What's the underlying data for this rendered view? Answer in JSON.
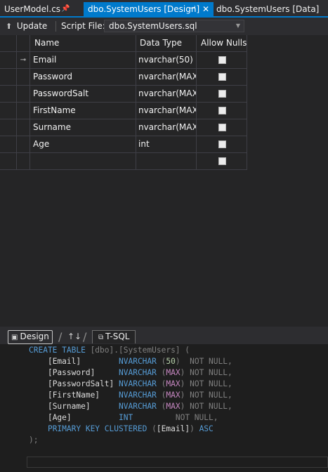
{
  "tabs": [
    {
      "label": "UserModel.cs",
      "pin": "📌"
    },
    {
      "label": "dbo.SystemUsers [Design]",
      "pin": "⊣",
      "close": "✕"
    },
    {
      "label": "dbo.SystemUsers [Data]"
    }
  ],
  "toolbar": {
    "update_label": "Update",
    "script_file_label": "Script File:",
    "script_file_value": "dbo.SystemUsers.sql"
  },
  "grid": {
    "headers": [
      "Name",
      "Data Type",
      "Allow Nulls"
    ],
    "rows": [
      {
        "name": "Email",
        "type": "nvarchar(50)",
        "allow_nulls": false,
        "primary_key": true
      },
      {
        "name": "Password",
        "type": "nvarchar(MAX)",
        "allow_nulls": false
      },
      {
        "name": "PasswordSalt",
        "type": "nvarchar(MAX)",
        "allow_nulls": false
      },
      {
        "name": "FirstName",
        "type": "nvarchar(MAX)",
        "allow_nulls": false
      },
      {
        "name": "Surname",
        "type": "nvarchar(MAX)",
        "allow_nulls": false
      },
      {
        "name": "Age",
        "type": "int",
        "allow_nulls": false
      },
      {
        "name": "",
        "type": "",
        "allow_nulls": false
      }
    ]
  },
  "pane_tabs": {
    "design": "Design",
    "swap": "↑↓",
    "tsql": "T-SQL"
  },
  "sql": {
    "line1": {
      "kw": "CREATE TABLE",
      "rest": " [dbo].[SystemUsers] ("
    },
    "columns": [
      {
        "name": "[Email]",
        "type": "NVARCHAR",
        "arg": "50",
        "suffix": "NOT NULL,"
      },
      {
        "name": "[Password]",
        "type": "NVARCHAR",
        "arg": "MAX",
        "suffix": "NOT NULL,"
      },
      {
        "name": "[PasswordSalt]",
        "type": "NVARCHAR",
        "arg": "MAX",
        "suffix": "NOT NULL,"
      },
      {
        "name": "[FirstName]",
        "type": "NVARCHAR",
        "arg": "MAX",
        "suffix": "NOT NULL,"
      },
      {
        "name": "[Surname]",
        "type": "NVARCHAR",
        "arg": "MAX",
        "suffix": "NOT NULL,"
      },
      {
        "name": "[Age]",
        "type": "INT",
        "arg": "",
        "suffix": "NOT NULL,"
      }
    ],
    "pk": {
      "kw": "PRIMARY KEY CLUSTERED",
      "col": "[Email]",
      "dir": "ASC"
    },
    "close": ");"
  },
  "colors": {
    "accent": "#007acc",
    "keyword": "#569cd6",
    "max": "#c586c0",
    "comment_gray": "#808080"
  }
}
